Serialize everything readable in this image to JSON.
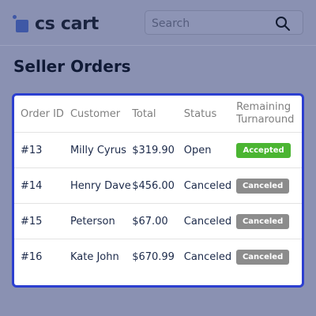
{
  "header": {
    "logo_text": "cs cart",
    "brand_color": "#3f58a6",
    "search": {
      "placeholder": "Search",
      "icon": "search-icon"
    }
  },
  "page": {
    "title": "Seller Orders"
  },
  "orders_table": {
    "columns": [
      "Order ID",
      "Customer",
      "Total",
      "Status",
      "Remaining Turnaround"
    ],
    "rows": [
      {
        "order_id": "#13",
        "customer": "Milly Cyrus",
        "total": "$319.90",
        "status": "Open",
        "turnaround": "Accepted"
      },
      {
        "order_id": "#14",
        "customer": "Henry Dave",
        "total": "$456.00",
        "status": "Canceled",
        "turnaround": "Canceled"
      },
      {
        "order_id": "#15",
        "customer": "Peterson",
        "total": "$67.00",
        "status": "Canceled",
        "turnaround": "Canceled"
      },
      {
        "order_id": "#16",
        "customer": "Kate John",
        "total": "$670.99",
        "status": "Canceled",
        "turnaround": "Canceled"
      }
    ],
    "badge_colors": {
      "Accepted": "#4bb532",
      "Canceled": "#8c8c8c"
    }
  }
}
